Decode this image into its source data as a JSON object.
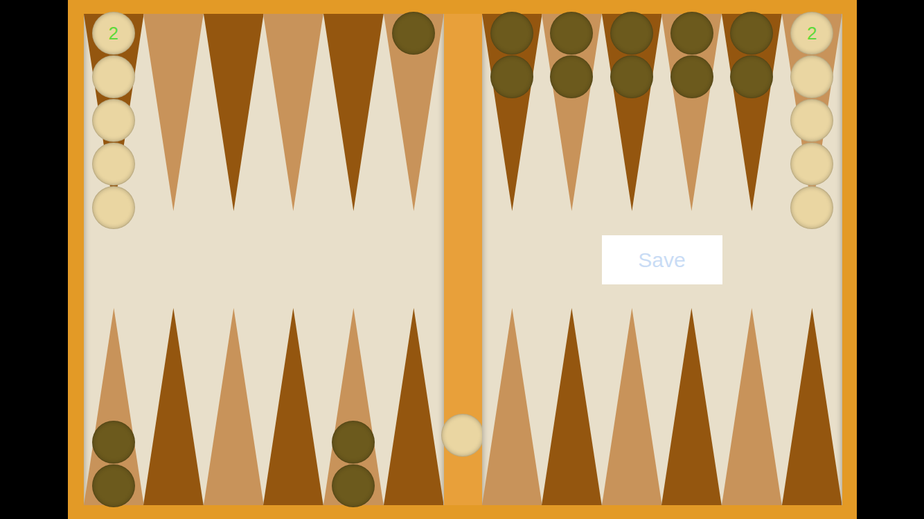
{
  "top_points": [
    {
      "checkers": 5,
      "color": "#ead6a2",
      "label": "2"
    },
    {
      "checkers": 0
    },
    {
      "checkers": 0
    },
    {
      "checkers": 0
    },
    {
      "checkers": 0
    },
    {
      "checkers": 1,
      "color": "#6c5a1d"
    },
    {
      "checkers": 2,
      "color": "#6c5a1d"
    },
    {
      "checkers": 2,
      "color": "#6c5a1d"
    },
    {
      "checkers": 2,
      "color": "#6c5a1d"
    },
    {
      "checkers": 2,
      "color": "#6c5a1d"
    },
    {
      "checkers": 2,
      "color": "#6c5a1d"
    },
    {
      "checkers": 5,
      "color": "#ead6a2",
      "label": "2"
    }
  ],
  "bottom_points": [
    {
      "checkers": 2,
      "color": "#6c5a1d"
    },
    {
      "checkers": 0
    },
    {
      "checkers": 0
    },
    {
      "checkers": 0
    },
    {
      "checkers": 2,
      "color": "#6c5a1d"
    },
    {
      "checkers": 0
    },
    {
      "checkers": 0
    },
    {
      "checkers": 0
    },
    {
      "checkers": 0
    },
    {
      "checkers": 0
    },
    {
      "checkers": 0
    },
    {
      "checkers": 0
    }
  ],
  "bar": {
    "checkers": [
      {
        "color": "#ead6a2"
      }
    ]
  },
  "save_button": {
    "label": "Save"
  }
}
